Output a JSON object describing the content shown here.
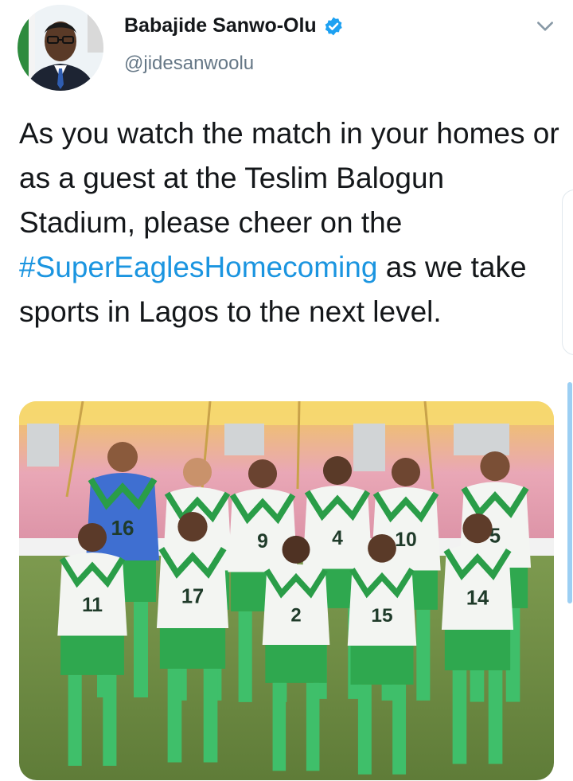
{
  "user": {
    "name": "Babajide Sanwo-Olu",
    "handle": "@jidesanwoolu",
    "verified": true
  },
  "tweet": {
    "text_before": "As you watch the match in your homes or as a guest at the Teslim Balogun Stadium, please cheer on the ",
    "hashtag": "#SuperEaglesHomecoming",
    "text_after": " as we take sports in Lagos to the next level."
  },
  "photo": {
    "jersey_numbers_back": [
      "16",
      "9",
      "4",
      "10",
      "5"
    ],
    "jersey_numbers_front": [
      "11",
      "17",
      "2",
      "15",
      "14"
    ]
  },
  "icons": {
    "verified": "verified-badge-icon",
    "menu": "chevron-down-icon"
  },
  "colors": {
    "hashtag": "#1b95e0",
    "verified": "#1da1f2",
    "handle": "#657786",
    "kit_green": "#2fa84f"
  }
}
